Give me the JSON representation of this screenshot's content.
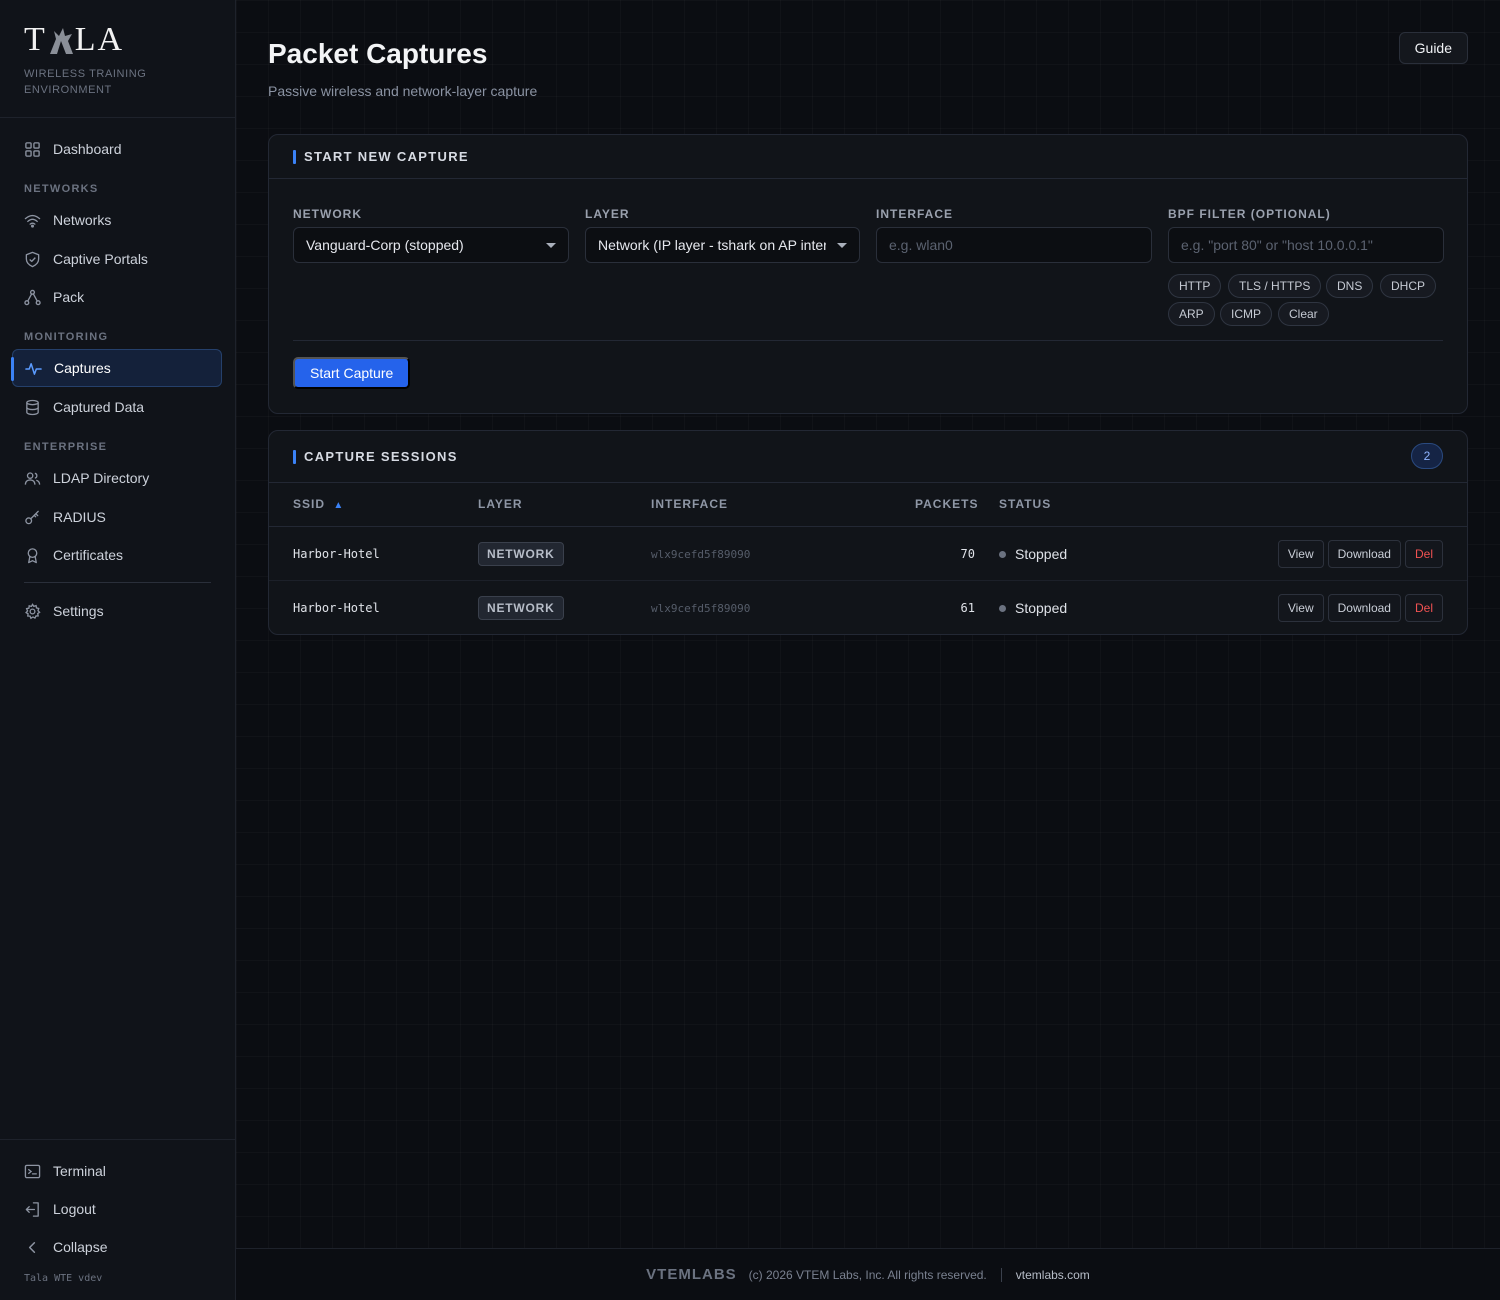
{
  "brand": {
    "logo_left": "T",
    "logo_right": "LA",
    "tagline": "WIRELESS TRAINING ENVIRONMENT"
  },
  "sidebar": {
    "dashboard": "Dashboard",
    "section_networks": "NETWORKS",
    "networks": "Networks",
    "captive_portals": "Captive Portals",
    "pack": "Pack",
    "section_monitoring": "MONITORING",
    "captures": "Captures",
    "captured_data": "Captured Data",
    "section_enterprise": "ENTERPRISE",
    "ldap": "LDAP Directory",
    "radius": "RADIUS",
    "certificates": "Certificates",
    "settings": "Settings",
    "terminal": "Terminal",
    "logout": "Logout",
    "collapse": "Collapse",
    "version": "Tala WTE vdev"
  },
  "header": {
    "title": "Packet Captures",
    "subtitle": "Passive wireless and network-layer capture",
    "guide": "Guide"
  },
  "new_capture": {
    "title": "START NEW CAPTURE",
    "network_label": "NETWORK",
    "network_value": "Vanguard-Corp (stopped)",
    "layer_label": "LAYER",
    "layer_value": "Network (IP layer - tshark on AP inter",
    "interface_label": "INTERFACE",
    "interface_placeholder": "e.g. wlan0",
    "bpf_label": "BPF FILTER (OPTIONAL)",
    "bpf_placeholder": "e.g. \"port 80\" or \"host 10.0.0.1\"",
    "chips": [
      "HTTP",
      "TLS / HTTPS",
      "DNS",
      "DHCP",
      "ARP",
      "ICMP",
      "Clear"
    ],
    "start_button": "Start Capture"
  },
  "sessions": {
    "title": "CAPTURE SESSIONS",
    "count": "2",
    "columns": {
      "ssid": "SSID",
      "sort_arrow": "▲",
      "layer": "LAYER",
      "interface": "INTERFACE",
      "packets": "PACKETS",
      "status": "STATUS"
    },
    "rows": [
      {
        "ssid": "Harbor-Hotel",
        "layer": "NETWORK",
        "interface": "wlx9cefd5f89090",
        "packets": "70",
        "status": "Stopped",
        "view": "View",
        "download": "Download",
        "del": "Del"
      },
      {
        "ssid": "Harbor-Hotel",
        "layer": "NETWORK",
        "interface": "wlx9cefd5f89090",
        "packets": "61",
        "status": "Stopped",
        "view": "View",
        "download": "Download",
        "del": "Del"
      }
    ]
  },
  "footer": {
    "brand": "VTEMLABS",
    "copyright": "(c) 2026 VTEM Labs, Inc. All rights reserved.",
    "link": "vtemlabs.com"
  },
  "colors": {
    "accent": "#3b82f6",
    "primary_button": "#2563eb",
    "danger": "#f05252"
  }
}
